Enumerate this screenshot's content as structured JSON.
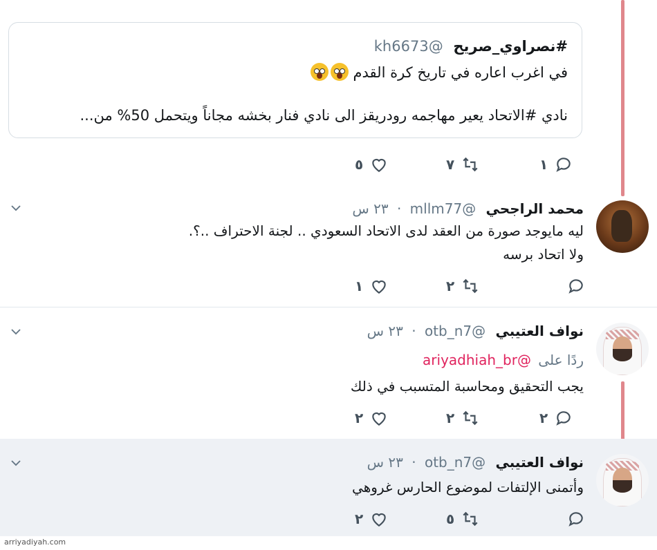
{
  "quote": {
    "hashtag": "#نصراوي_صريح",
    "handle": "@kh6673",
    "line1": "في اغرب اعاره في تاريخ كرة القدم",
    "line2": "نادي #الاتحاد يعير مهاجمه رودريقز الى نادي فنار بخشه مجاناً ويتحمل 50% من...",
    "emoji": "face-screaming-in-fear-icon",
    "counts": {
      "replies": "١",
      "retweets": "٧",
      "likes": "٥"
    }
  },
  "tweets": [
    {
      "name": "محمد الراجحي",
      "handle": "@mllm77",
      "time": "٢٣ س",
      "lines": [
        "ليه مايوجد صورة من العقد لدى الاتحاد السعودي .. لجنة الاحتراف ..؟.",
        "ولا اتحاد برسه"
      ],
      "counts": {
        "replies": "",
        "retweets": "٢",
        "likes": "١"
      }
    },
    {
      "name": "نواف العتيبي",
      "handle": "@otb_n7",
      "time": "٢٣ س",
      "reply_prefix": "ردًا على",
      "reply_to": "@ariyadhiah_br",
      "lines": [
        "يجب التحقيق ومحاسبة المتسبب في ذلك"
      ],
      "counts": {
        "replies": "٢",
        "retweets": "٢",
        "likes": "٢"
      }
    },
    {
      "name": "نواف العتيبي",
      "handle": "@otb_n7",
      "time": "٢٣ س",
      "lines": [
        "وأتمنى الإلتفات لموضوع الحارس غروهي"
      ],
      "counts": {
        "replies": "",
        "retweets": "٥",
        "likes": "٢"
      }
    }
  ],
  "separator": "·",
  "watermark": "arriyadiyah.com",
  "colors": {
    "thread_line": "#e0878c",
    "mention": "#e0245e",
    "highlight_bg": "#eef1f5"
  }
}
